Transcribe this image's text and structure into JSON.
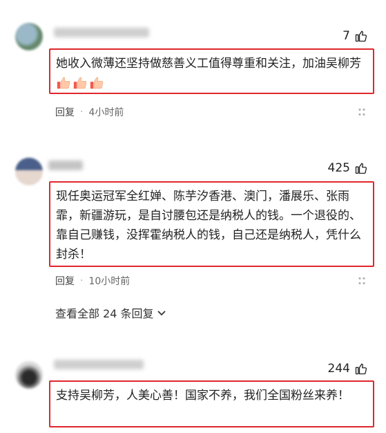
{
  "comments": [
    {
      "likes": "7",
      "text": "她收入微薄还坚持做慈善义工值得尊重和关注，加油吴柳芳",
      "reply_label": "回复",
      "time": "4小时前"
    },
    {
      "likes": "425",
      "text": "现任奥运冠军全红婵、陈芋汐香港、澳门，潘展乐、张雨霏，新疆游玩，是自讨腰包还是纳税人的钱。一个退役的、靠自己赚钱，没挥霍纳税人的钱，自己还是纳税人，凭什么封杀！",
      "reply_label": "回复",
      "time": "10小时前",
      "view_replies": "查看全部 24 条回复"
    },
    {
      "likes": "244",
      "text": "支持吴柳芳，人美心善！国家不养，我们全国粉丝来养！"
    }
  ],
  "colors": {
    "highlight_border": "#e0262b",
    "meta_text": "#666666"
  },
  "icons": {
    "like": "thumbs-up-outline-icon",
    "emoji": "thumbs-up-emoji-icon",
    "more": "more-dots-icon",
    "chevron": "chevron-down-icon"
  }
}
